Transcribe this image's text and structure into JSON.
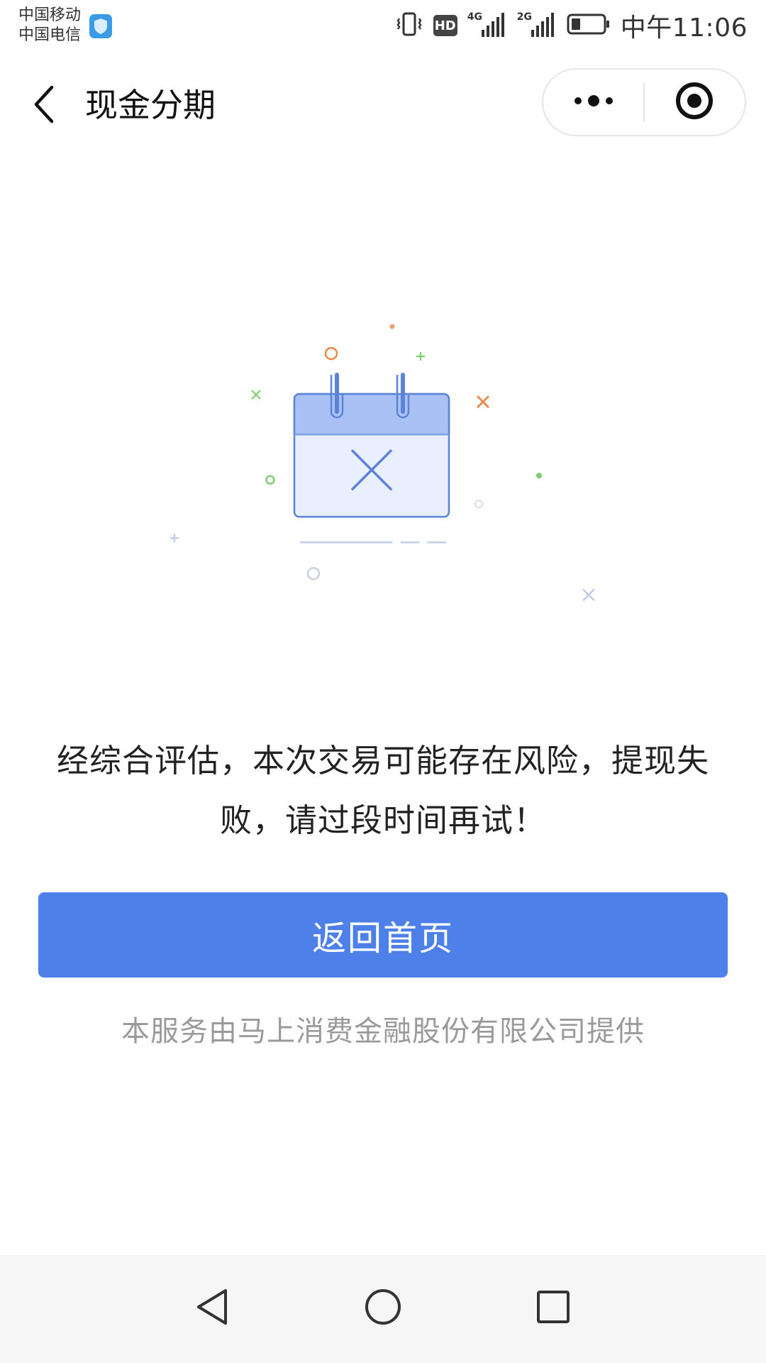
{
  "status_bar": {
    "carrier_1": "中国移动",
    "carrier_2": "中国电信",
    "hd_label": "HD",
    "network_1": "4G",
    "network_2": "2G",
    "time": "中午11:06"
  },
  "nav": {
    "title": "现金分期"
  },
  "content": {
    "message_line_1": "经综合评估，本次交易可能存在风险，提现失",
    "message_line_2": "败，请过段时间再试！",
    "home_button_label": "返回首页",
    "provider_text": "本服务由马上消费金融股份有限公司提供"
  },
  "colors": {
    "primary": "#4e80ea",
    "calendar_header": "#a9c1f4",
    "calendar_body": "#e9efff",
    "calendar_stroke": "#5b84d8"
  },
  "icons": {
    "back": "chevron-left-icon",
    "more": "more-dots-icon",
    "close": "target-close-icon",
    "illustration": "calendar-cross-icon"
  }
}
